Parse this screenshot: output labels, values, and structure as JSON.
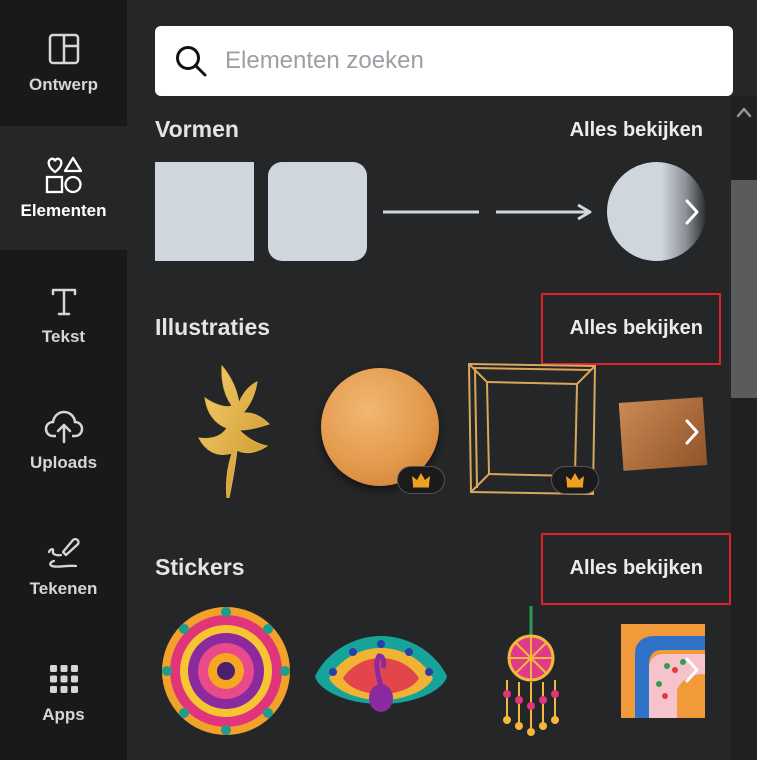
{
  "rail": {
    "items": [
      {
        "label": "Ontwerp",
        "icon": "layout-icon"
      },
      {
        "label": "Elementen",
        "icon": "shapes-icon"
      },
      {
        "label": "Tekst",
        "icon": "text-icon"
      },
      {
        "label": "Uploads",
        "icon": "cloud-upload-icon"
      },
      {
        "label": "Tekenen",
        "icon": "draw-icon"
      },
      {
        "label": "Apps",
        "icon": "apps-grid-icon"
      }
    ],
    "active": "Elementen"
  },
  "search": {
    "placeholder": "Elementen zoeken"
  },
  "sections": {
    "vormen": {
      "title": "Vormen",
      "see_all": "Alles bekijken"
    },
    "illustraties": {
      "title": "Illustraties",
      "see_all": "Alles bekijken"
    },
    "stickers": {
      "title": "Stickers",
      "see_all": "Alles bekijken"
    }
  },
  "colors": {
    "panel_bg": "#252627",
    "rail_bg": "#18191b",
    "shape_fill": "#cfd6de",
    "highlight": "#e0202a"
  }
}
